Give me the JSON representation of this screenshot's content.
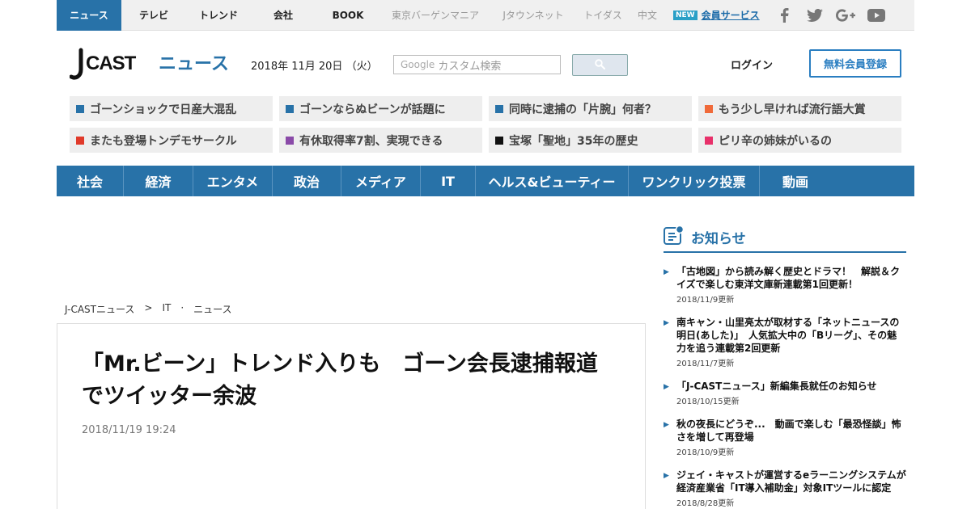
{
  "topnav": {
    "items": [
      {
        "label": "ニュース",
        "active": true,
        "dim": false
      },
      {
        "label": "テレビ",
        "active": false,
        "dim": false
      },
      {
        "label": "トレンド",
        "active": false,
        "dim": false
      },
      {
        "label": "会社",
        "active": false,
        "dim": false
      },
      {
        "label": "BOOK",
        "active": false,
        "dim": false
      },
      {
        "label": "東京バーゲンマニア",
        "active": false,
        "dim": true
      },
      {
        "label": "Jタウンネット",
        "active": false,
        "dim": true
      },
      {
        "label": "トイダス",
        "active": false,
        "dim": true
      },
      {
        "label": "中文",
        "active": false,
        "dim": true
      }
    ],
    "new_badge": "NEW",
    "member_service": "会員サービス",
    "social_icons": [
      "facebook-icon",
      "twitter-icon",
      "google-plus-icon",
      "youtube-icon"
    ]
  },
  "header": {
    "logo_text": "J-CASTニュース",
    "date": "2018年 11月 20日 （火）",
    "search_placeholder": "カスタム検索",
    "search_brand": "Google",
    "login": "ログイン",
    "register": "無料会員登録"
  },
  "topics": [
    {
      "label": "ゴーンショックで日産大混乱",
      "color": "#2872a8"
    },
    {
      "label": "ゴーンならぬビーンが話題に",
      "color": "#2872a8"
    },
    {
      "label": "同時に逮捕の「片腕」何者？",
      "color": "#2872a8"
    },
    {
      "label": "もう少し早ければ流行語大賞",
      "color": "#f06a3a"
    },
    {
      "label": "またも登場トンデモサークル",
      "color": "#e03a2a"
    },
    {
      "label": "有休取得率7割、実現できる",
      "color": "#8a4aa8"
    },
    {
      "label": "宝塚「聖地」35年の歴史",
      "color": "#111111"
    },
    {
      "label": "ピリ辛の姉妹がいるの",
      "color": "#e8306a"
    }
  ],
  "categories": [
    "社会",
    "経済",
    "エンタメ",
    "政治",
    "メディア",
    "IT",
    "ヘルス&ビューティー",
    "ワンクリック投票",
    "動画"
  ],
  "breadcrumb": [
    "J-CASTニュース",
    ">",
    "IT",
    "·",
    "ニュース"
  ],
  "article": {
    "headline": "「Mr.ビーン」トレンド入りも　ゴーン会長逮捕報道でツイッター余波",
    "date": "2018/11/19 19:24"
  },
  "sidebar": {
    "title": "お知らせ",
    "items": [
      {
        "title": "「古地図」から読み解く歴史とドラマ！　解説＆クイズで楽しむ東洋文庫新連載第1回更新！",
        "date": "2018/11/9更新"
      },
      {
        "title": "南キャン・山里亮太が取材する「ネットニュースの明日(あした)」　人気拡大中の「Bリーグ」、その魅力を追う連載第2回更新",
        "date": "2018/11/7更新"
      },
      {
        "title": "「J-CASTニュース」新編集長就任のお知らせ",
        "date": "2018/10/15更新"
      },
      {
        "title": "秋の夜長にどうぞ...　動画で楽しむ「最恐怪談」怖さを増して再登場",
        "date": "2018/10/9更新"
      },
      {
        "title": "ジェイ・キャストが運営するeラーニングシステムが経済産業省「IT導入補助金」対象ITツールに認定",
        "date": "2018/8/28更新"
      }
    ]
  }
}
